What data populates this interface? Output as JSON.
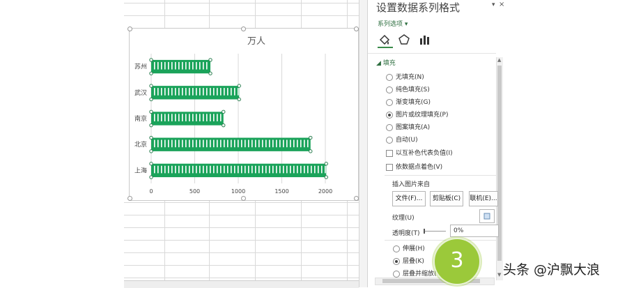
{
  "chart_data": {
    "type": "bar",
    "title": "万人",
    "categories": [
      "苏州",
      "武汉",
      "南京",
      "北京",
      "上海"
    ],
    "values": [
      680,
      1010,
      830,
      1830,
      2010
    ],
    "xticks": [
      "0",
      "500",
      "1000",
      "1500",
      "2000"
    ],
    "xlim": [
      0,
      2000
    ],
    "grid": true,
    "bar_color": "#1aa35a"
  },
  "pane": {
    "title": "设置数据系列格式",
    "series_options": "系列选项",
    "section_fill": "填充",
    "fill_options": [
      "无填充(N)",
      "纯色填充(S)",
      "渐变填充(G)",
      "图片或纹理填充(P)",
      "图案填充(A)",
      "自动(U)"
    ],
    "selected_fill": "图片或纹理填充(P)",
    "invert_label": "以互补色代表负值(I)",
    "vary_label": "依数据点着色(V)",
    "insert_from": "插入图片来自",
    "btn_file": "文件(F)...",
    "btn_clipboard": "剪贴板(C)",
    "btn_online": "联机(E)...",
    "texture_label": "纹理(U)",
    "transparency_label": "透明度(T)",
    "transparency_value": "0%",
    "stretch_label": "伸展(H)",
    "stack_label": "层叠(K)",
    "stack_scale_label": "层叠并缩放(W)"
  },
  "badge": "3",
  "watermark": "头条 @沪飘大浪"
}
